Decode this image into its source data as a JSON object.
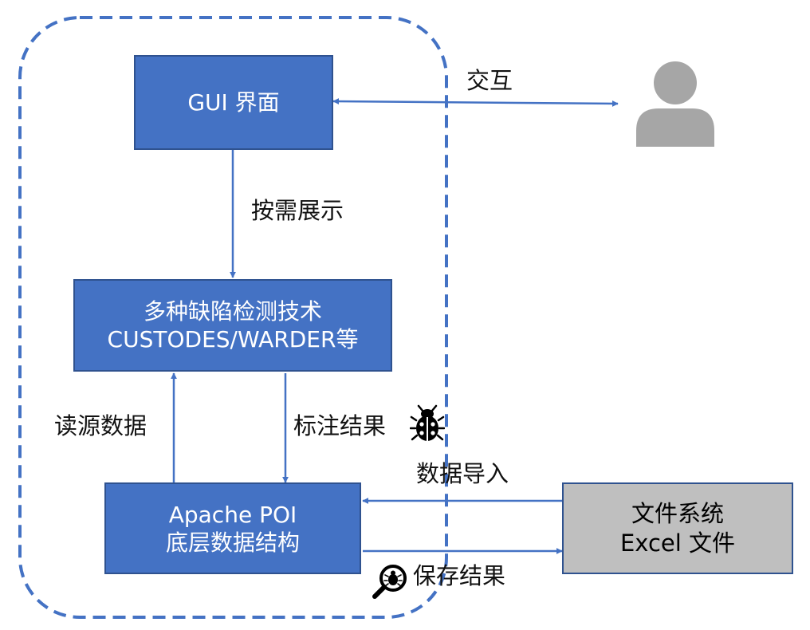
{
  "diagram": {
    "nodes": {
      "gui": {
        "label": "GUI 界面"
      },
      "detect": {
        "line1": "多种缺陷检测技术",
        "line2": "CUSTODES/WARDER等"
      },
      "poi": {
        "line1": "Apache POI",
        "line2": "底层数据结构"
      },
      "fs": {
        "line1": "文件系统",
        "line2": "Excel 文件"
      }
    },
    "edges": {
      "interact": "交互",
      "show": "按需展示",
      "read": "读源数据",
      "mark": "标注结果",
      "import": "数据导入",
      "save": "保存结果"
    },
    "icons": {
      "user": "user-icon",
      "bug": "bug-icon",
      "search_bug": "bug-search-icon"
    },
    "colors": {
      "node_fill": "#4472c4",
      "node_border": "#2f528f",
      "file_node_fill": "#bfbfbf",
      "arrow": "#4472c4",
      "boundary": "#4472c4",
      "user": "#a6a6a6"
    }
  }
}
